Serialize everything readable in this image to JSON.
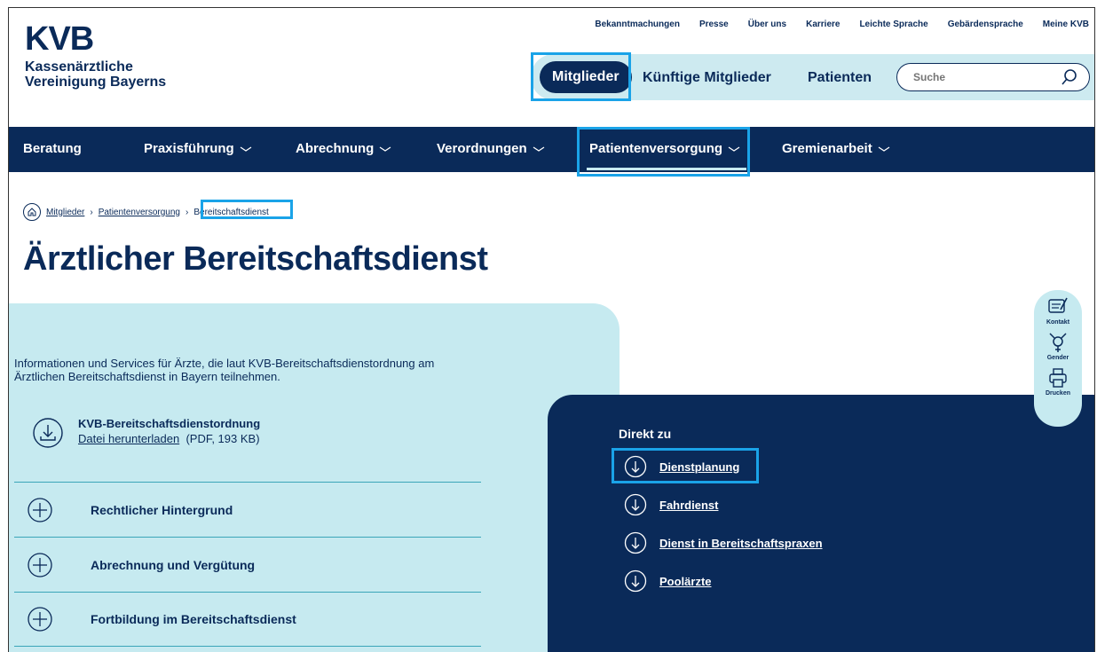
{
  "logo": {
    "mark": "KVB",
    "line1": "Kassenärztliche",
    "line2": "Vereinigung Bayerns"
  },
  "topnav": [
    "Bekanntmachungen",
    "Presse",
    "Über uns",
    "Karriere",
    "Leichte Sprache",
    "Gebärdensprache",
    "Meine KVB"
  ],
  "mainnav": {
    "active": "Mitglieder",
    "items": [
      "Künftige Mitglieder",
      "Patienten"
    ]
  },
  "search": {
    "placeholder": "Suche"
  },
  "darknav": [
    "Beratung",
    "Praxisführung",
    "Abrechnung",
    "Verordnungen",
    "Patientenversorgung",
    "Gremienarbeit"
  ],
  "breadcrumb": [
    "Mitglieder",
    "Patientenversorgung",
    "Bereitschaftsdienst"
  ],
  "page_title": "Ärztlicher Bereitschaftsdienst",
  "intro": "Informationen und Services für Ärzte, die laut KVB-Bereitschaftsdienstordnung am Ärztlichen Bereitschaftsdienst in Bayern teilnehmen.",
  "download": {
    "title": "KVB-Bereitschaftsdienstordnung",
    "link": "Datei herunterladen",
    "meta": "(PDF, 193 KB)"
  },
  "accordion": [
    "Rechtlicher Hintergrund",
    "Abrechnung und Vergütung",
    "Fortbildung im Bereitschaftsdienst"
  ],
  "direkt_zu": {
    "title": "Direkt zu",
    "items": [
      "Dienstplanung",
      "Fahrdienst",
      "Dienst in Bereitschaftspraxen",
      "Poolärzte"
    ]
  },
  "side_widget": [
    "Kontakt",
    "Gender",
    "Drucken"
  ],
  "colors": {
    "navy": "#0a2a59",
    "light": "#c6eaf0",
    "highlight": "#1aa3e8"
  }
}
